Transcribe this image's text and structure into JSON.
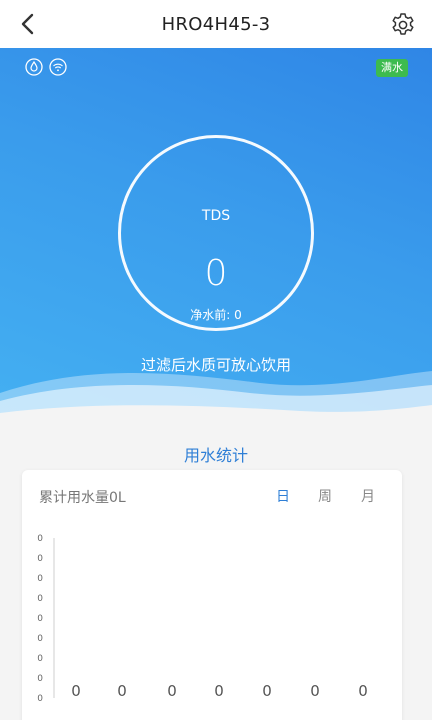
{
  "header": {
    "title": "HRO4H45-3",
    "back_icon": "chevron-left-icon",
    "settings_icon": "gear-icon"
  },
  "status": {
    "badge": "满水",
    "icons": [
      "water-drop-icon",
      "wifi-icon"
    ]
  },
  "tds": {
    "label": "TDS",
    "value": "0",
    "before": "净水前: 0"
  },
  "note": "过滤后水质可放心饮用",
  "stats": {
    "section_title": "用水统计",
    "total": "累计用水量0L",
    "periods": [
      "日",
      "周",
      "月"
    ],
    "active_period": "日"
  },
  "colors": {
    "accent": "#2f7fd6",
    "hero_top": "#2f86e6",
    "hero_bottom": "#44b0f2",
    "badge": "#3dbb4f"
  },
  "chart_data": {
    "type": "bar",
    "y_ticks": [
      "0",
      "0",
      "0",
      "0",
      "0",
      "0",
      "0",
      "0",
      "0"
    ],
    "values": [
      0,
      0,
      0,
      0,
      0,
      0,
      0
    ],
    "value_labels": [
      "0",
      "0",
      "0",
      "0",
      "0",
      "0",
      "0"
    ]
  }
}
